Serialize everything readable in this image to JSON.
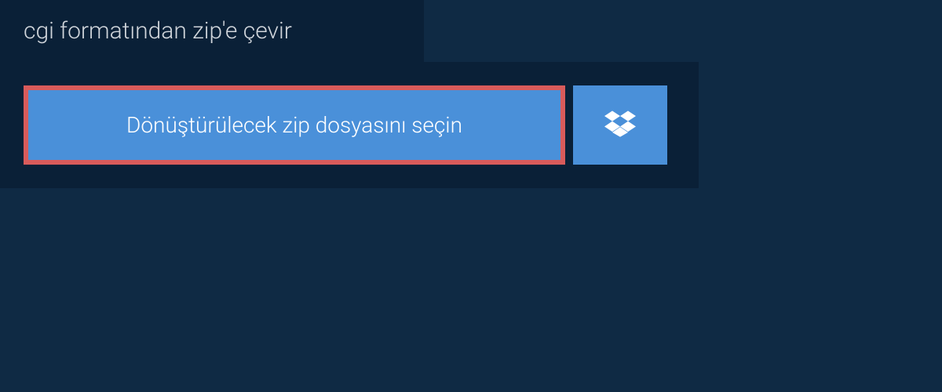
{
  "header": {
    "title": "cgi formatından zip'e çevir"
  },
  "actions": {
    "select_file_label": "Dönüştürülecek zip dosyasını seçin",
    "dropbox_icon": "dropbox"
  },
  "colors": {
    "background_dark": "#0f2a44",
    "panel_dark": "#0a2037",
    "button_blue": "#4a90d9",
    "highlight_border": "#d95b5b",
    "text_light": "#d0d5db",
    "text_white": "#ffffff"
  }
}
